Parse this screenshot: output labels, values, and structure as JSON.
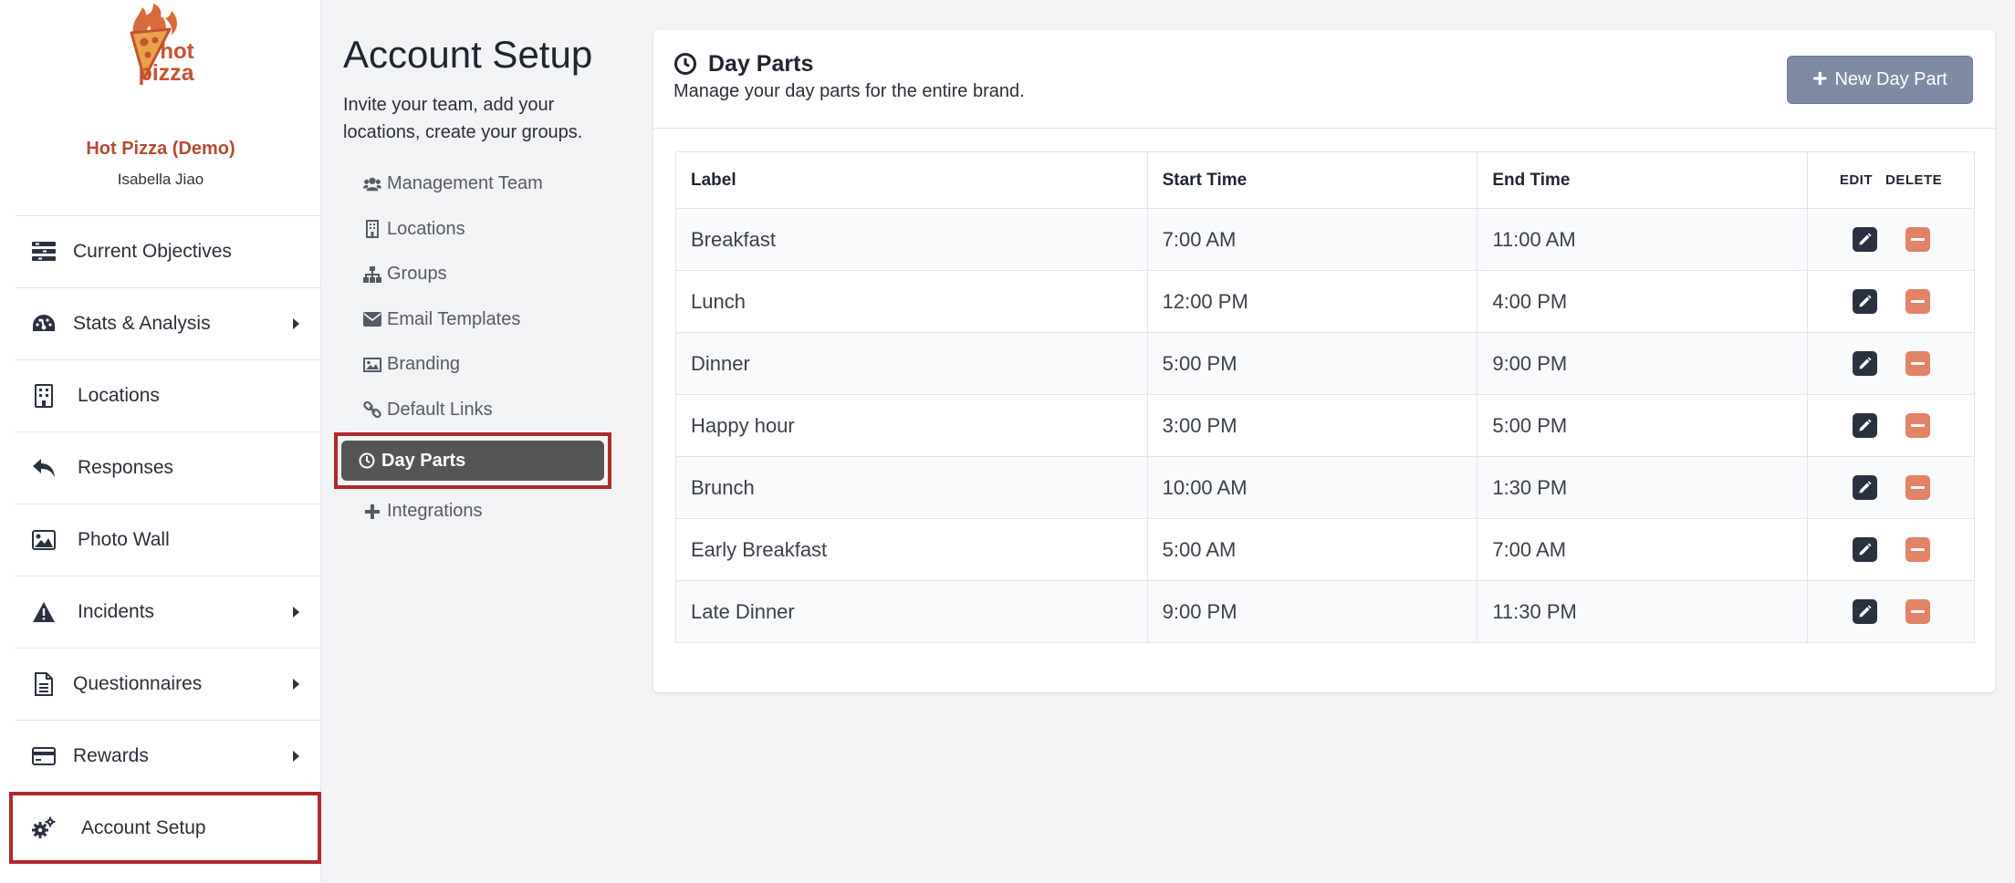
{
  "brand": {
    "logo_text_line1": "hot",
    "logo_text_line2": "pizza",
    "name": "Hot Pizza (Demo)",
    "user": "Isabella Jiao",
    "accent_color": "#b54a33"
  },
  "sidebar": {
    "items": [
      {
        "label": "Current Objectives",
        "icon": "objectives-icon",
        "has_submenu": false
      },
      {
        "label": "Stats & Analysis",
        "icon": "dashboard-gauge-icon",
        "has_submenu": true
      },
      {
        "label": "Locations",
        "icon": "building-icon",
        "has_submenu": false
      },
      {
        "label": "Responses",
        "icon": "reply-arrow-icon",
        "has_submenu": false
      },
      {
        "label": "Photo Wall",
        "icon": "image-icon",
        "has_submenu": false
      },
      {
        "label": "Incidents",
        "icon": "warning-icon",
        "has_submenu": true
      },
      {
        "label": "Questionnaires",
        "icon": "document-icon",
        "has_submenu": true
      },
      {
        "label": "Rewards",
        "icon": "credit-card-icon",
        "has_submenu": true
      },
      {
        "label": "Account Setup",
        "icon": "gears-icon",
        "has_submenu": false,
        "active": true
      }
    ]
  },
  "setup": {
    "title": "Account Setup",
    "description": "Invite your team, add your locations, create your groups.",
    "subnav": [
      {
        "label": "Management Team",
        "icon": "users-icon"
      },
      {
        "label": "Locations",
        "icon": "building-icon"
      },
      {
        "label": "Groups",
        "icon": "sitemap-icon"
      },
      {
        "label": "Email Templates",
        "icon": "envelope-icon"
      },
      {
        "label": "Branding",
        "icon": "image-icon"
      },
      {
        "label": "Default Links",
        "icon": "link-icon"
      },
      {
        "label": "Day Parts",
        "icon": "clock-icon",
        "active": true
      },
      {
        "label": "Integrations",
        "icon": "plus-icon"
      }
    ]
  },
  "card": {
    "title": "Day Parts",
    "subtitle": "Manage your day parts for the entire brand.",
    "new_button_label": "New Day Part"
  },
  "table": {
    "columns": {
      "label": "Label",
      "start": "Start Time",
      "end": "End Time",
      "edit": "EDIT",
      "delete": "DELETE"
    },
    "rows": [
      {
        "label": "Breakfast",
        "start": "7:00 AM",
        "end": "11:00 AM"
      },
      {
        "label": "Lunch",
        "start": "12:00 PM",
        "end": "4:00 PM"
      },
      {
        "label": "Dinner",
        "start": "5:00 PM",
        "end": "9:00 PM"
      },
      {
        "label": "Happy hour",
        "start": "3:00 PM",
        "end": "5:00 PM"
      },
      {
        "label": "Brunch",
        "start": "10:00 AM",
        "end": "1:30 PM"
      },
      {
        "label": "Early Breakfast",
        "start": "5:00 AM",
        "end": "7:00 AM"
      },
      {
        "label": "Late Dinner",
        "start": "9:00 PM",
        "end": "11:30 PM"
      }
    ]
  },
  "colors": {
    "highlight_border": "#b0292b",
    "new_button": "#7f8aa5",
    "edit_button": "#2a3140",
    "delete_button": "#e28267",
    "active_subnav": "#555555"
  }
}
